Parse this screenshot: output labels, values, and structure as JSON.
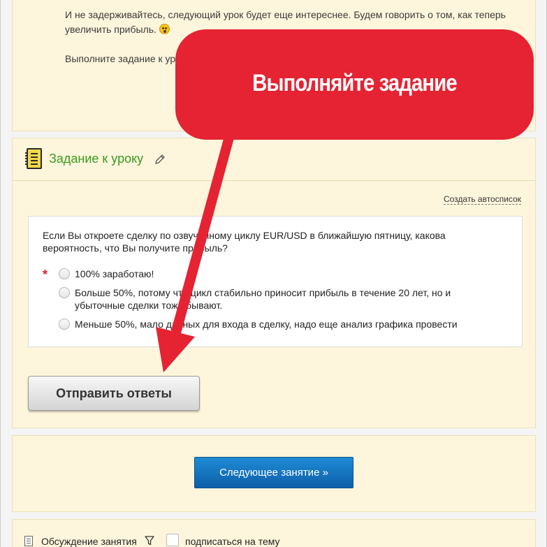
{
  "lesson": {
    "paragraph1": "И не задерживайтесь, следующий урок будет еще интереснее. Будем говорить о том, как теперь увеличить прибыль.",
    "paragraph2": "Выполните задание к уроку"
  },
  "task": {
    "title": "Задание к уроку",
    "autolist_link": "Создать автосписок",
    "question": "Если Вы откроете сделку по озвученному циклу EUR/USD в ближайшую пятницу, какова вероятность, что Вы получите прибыль?",
    "required_mark": "*",
    "options": [
      "100% заработаю!",
      "Больше 50%, потому что цикл стабильно приносит прибыль в течение 20 лет, но и убыточные сделки тоже бывают.",
      "Меньше 50%, мало данных для входа в сделку, надо еще анализ графика провести"
    ],
    "submit_label": "Отправить ответы"
  },
  "next": {
    "label": "Следующее занятие »"
  },
  "discussion": {
    "label": "Обсуждение занятия",
    "subscribe_label": "подписаться на тему"
  },
  "annotation": {
    "callout_text": "Выполняйте задание",
    "color": "#e52333"
  },
  "icons": {
    "task": "notepad-icon",
    "edit": "pencil-icon",
    "discussion": "document-icon",
    "filter": "filter-icon",
    "emoji": "surprised-emoji-icon"
  }
}
